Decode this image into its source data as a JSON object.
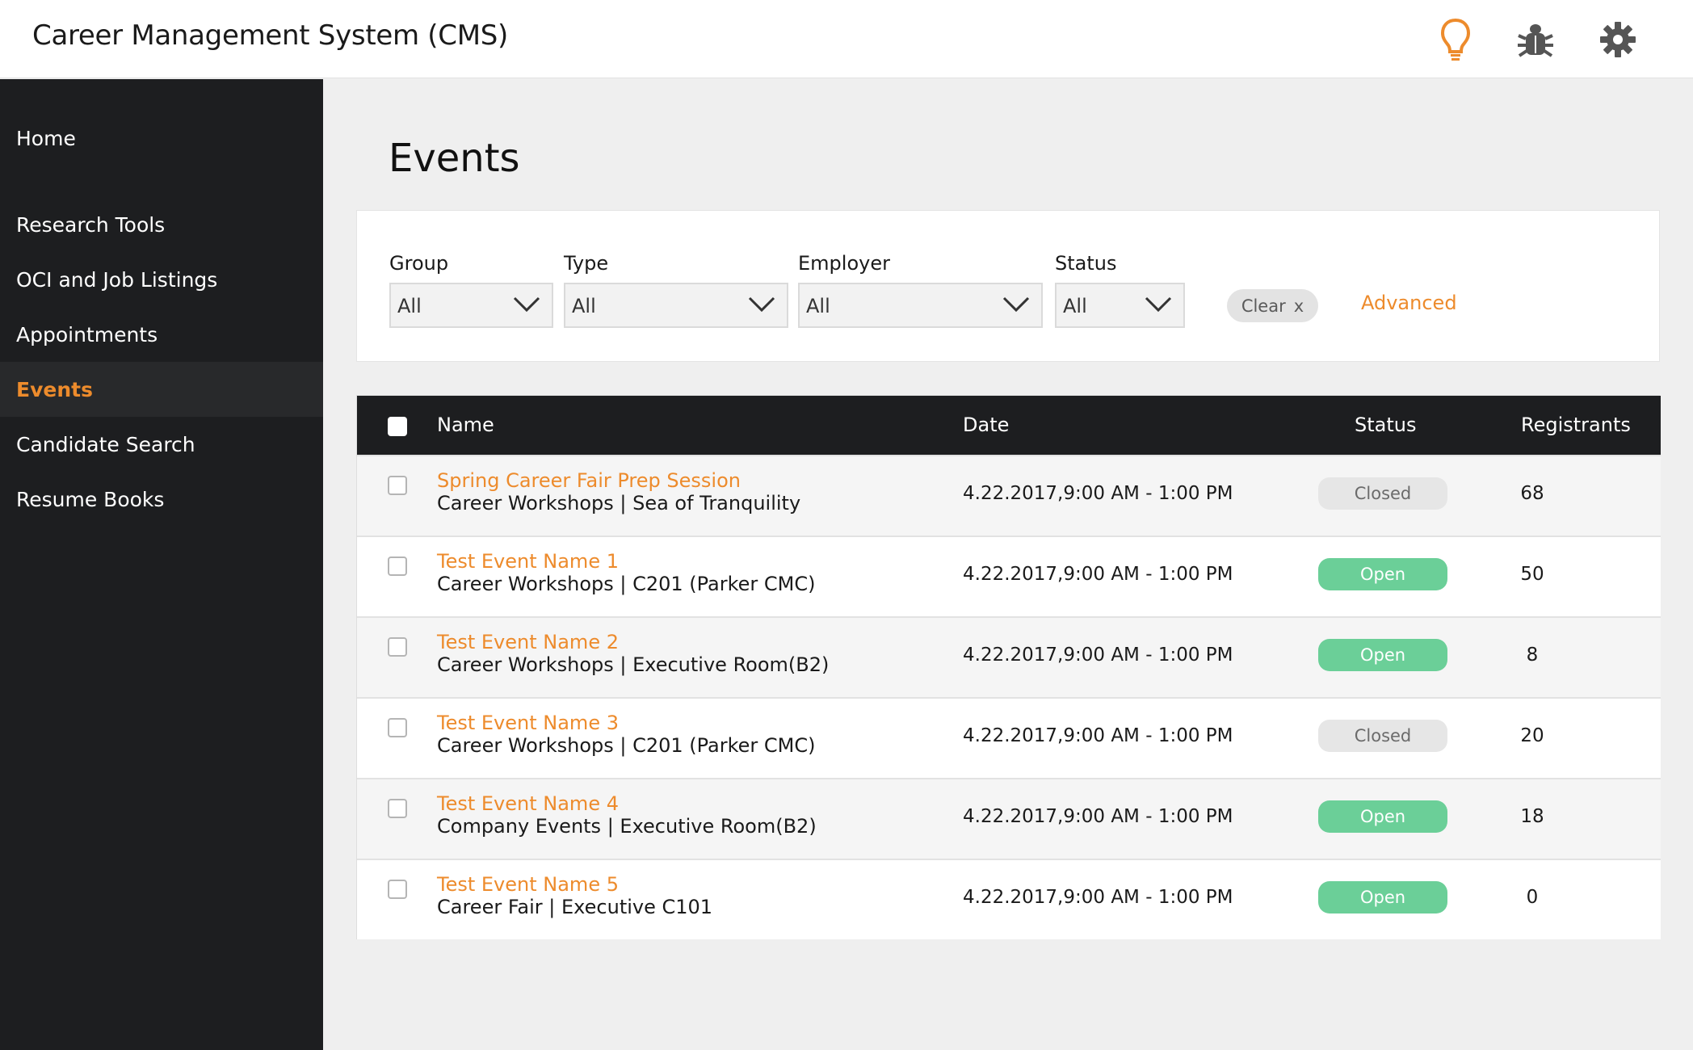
{
  "header": {
    "title": "Career Management System (CMS)",
    "icons": [
      "lightbulb-icon",
      "bug-icon",
      "gear-icon"
    ],
    "accent_color": "#ed8b2c"
  },
  "sidebar": {
    "items": [
      {
        "label": "Home",
        "active": false
      },
      {
        "label": "Research Tools",
        "active": false
      },
      {
        "label": "OCI and Job Listings",
        "active": false
      },
      {
        "label": "Appointments",
        "active": false
      },
      {
        "label": "Events",
        "active": true
      },
      {
        "label": "Candidate Search",
        "active": false
      },
      {
        "label": "Resume Books",
        "active": false
      }
    ]
  },
  "main": {
    "title": "Events"
  },
  "filters": {
    "group": {
      "label": "Group",
      "value": "All"
    },
    "type": {
      "label": "Type",
      "value": "All"
    },
    "employer": {
      "label": "Employer",
      "value": "All"
    },
    "status": {
      "label": "Status",
      "value": "All"
    },
    "clear_label": "Clear",
    "clear_x": "x",
    "advanced_label": "Advanced"
  },
  "table": {
    "columns": {
      "name": "Name",
      "date": "Date",
      "status": "Status",
      "registrants": "Registrants"
    },
    "rows": [
      {
        "name": "Spring Career Fair Prep Session",
        "sub": "Career Workshops | Sea of Tranquility",
        "date": "4.22.2017,9:00 AM - 1:00 PM",
        "status": "Closed",
        "registrants": "68"
      },
      {
        "name": "Test Event Name 1",
        "sub": "Career Workshops | C201 (Parker CMC)",
        "date": "4.22.2017,9:00 AM - 1:00 PM",
        "status": "Open",
        "registrants": "50"
      },
      {
        "name": "Test Event Name 2",
        "sub": "Career Workshops | Executive Room(B2)",
        "date": "4.22.2017,9:00 AM - 1:00 PM",
        "status": "Open",
        "registrants": "8"
      },
      {
        "name": "Test Event Name 3",
        "sub": "Career Workshops | C201 (Parker CMC)",
        "date": "4.22.2017,9:00 AM - 1:00 PM",
        "status": "Closed",
        "registrants": "20"
      },
      {
        "name": "Test Event Name 4",
        "sub": "Company Events | Executive Room(B2)",
        "date": "4.22.2017,9:00 AM - 1:00 PM",
        "status": "Open",
        "registrants": "18"
      },
      {
        "name": "Test Event Name 5",
        "sub": "Career Fair | Executive C101",
        "date": "4.22.2017,9:00 AM - 1:00 PM",
        "status": "Open",
        "registrants": "0"
      }
    ],
    "status_colors": {
      "Open": "#6bcf98",
      "Closed": "#e6e6e6"
    }
  }
}
